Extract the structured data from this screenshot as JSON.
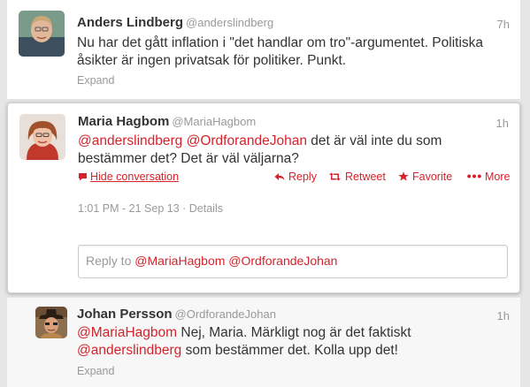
{
  "tweets": [
    {
      "fullname": "Anders Lindberg",
      "username": "@anderslindberg",
      "time": "7h",
      "text_line1": "Nu har det gått inflation i \"det handlar om tro\"-argumentet. Politiska",
      "text_line2": "åsikter är ingen privatsak för politiker. Punkt.",
      "expand": "Expand"
    },
    {
      "fullname": "Maria Hagbom",
      "username": "@MariaHagbom",
      "time": "1h",
      "mention1": "@anderslindberg",
      "mention2": "@OrdforandeJohan",
      "text_line1_rest": " det är väl inte du som",
      "text_line2": "bestämmer det? Det är väl väljarna?",
      "hide_conversation": "Hide conversation",
      "actions": {
        "reply": "Reply",
        "retweet": "Retweet",
        "favorite": "Favorite",
        "more": "More"
      },
      "timestamp": "1:01 PM - 21 Sep 13",
      "details": "Details",
      "reply_box": {
        "prefix": "Reply to ",
        "mention1": "@MariaHagbom",
        "mention2": "@OrdforandeJohan"
      }
    },
    {
      "fullname": "Johan Persson",
      "username": "@OrdforandeJohan",
      "time": "1h",
      "mention1": "@MariaHagbom",
      "text_line1_rest": " Nej, Maria. Märkligt nog är det faktiskt",
      "mention2": "@anderslindberg",
      "text_line2_rest": " som bestämmer det. Kolla upp det!",
      "expand": "Expand"
    }
  ],
  "colors": {
    "accent": "#d4232b",
    "meta_gray": "#999999",
    "text": "#333333",
    "background": "#e6e6e6"
  },
  "icons": {
    "hide": "speech-bubble-icon",
    "reply": "reply-arrow-icon",
    "retweet": "retweet-icon",
    "favorite": "star-icon",
    "more": "more-dots-icon"
  }
}
